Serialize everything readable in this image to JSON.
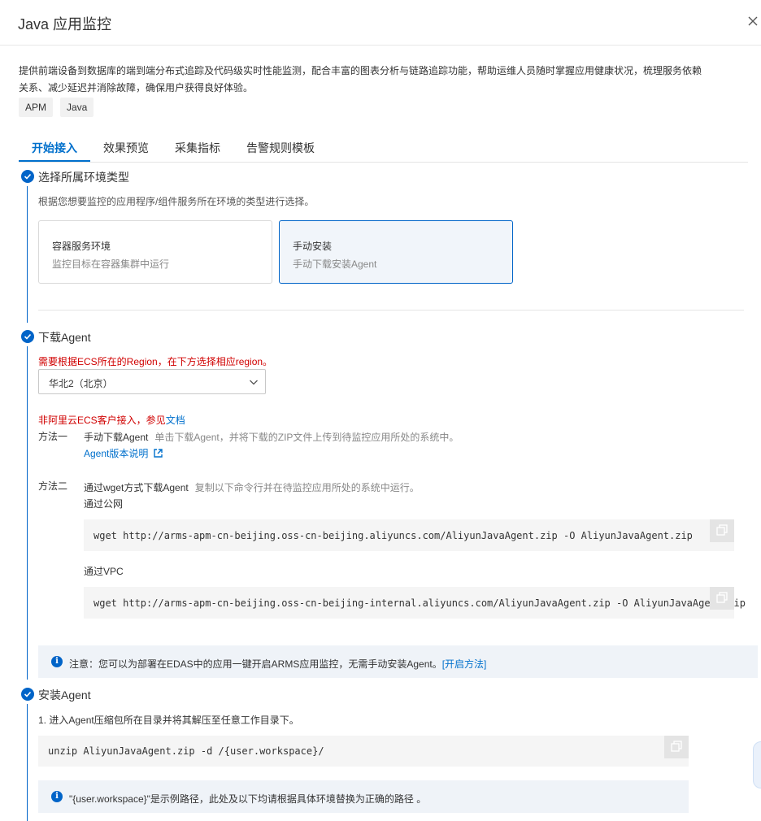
{
  "header": {
    "title": "Java 应用监控"
  },
  "description": "提供前端设备到数据库的端到端分布式追踪及代码级实时性能监测，配合丰富的图表分析与链路追踪功能，帮助运维人员随时掌握应用健康状况，梳理服务依赖关系、减少延迟并消除故障，确保用户获得良好体验。",
  "tags": [
    "APM",
    "Java"
  ],
  "tabs": [
    "开始接入",
    "效果预览",
    "采集指标",
    "告警规则模板"
  ],
  "step1": {
    "title": "选择所属环境类型",
    "hint": "根据您想要监控的应用程序/组件服务所在环境的类型进行选择。",
    "cards": [
      {
        "title": "容器服务环境",
        "subtitle": "监控目标在容器集群中运行"
      },
      {
        "title": "手动安装",
        "subtitle": "手动下载安装Agent"
      }
    ]
  },
  "step2": {
    "title": "下载Agent",
    "region_warning": "需要根据ECS所在的Region，在下方选择相应region。",
    "region_value": "华北2（北京）",
    "non_aliyun_text": "非阿里云ECS客户接入，参见",
    "non_aliyun_link": "文档",
    "method1": {
      "label": "方法一",
      "name": "手动下载Agent",
      "desc": "单击下载Agent，并将下载的ZIP文件上传到待监控应用所处的系统中。",
      "link": "Agent版本说明"
    },
    "method2": {
      "label": "方法二",
      "name": "通过wget方式下载Agent",
      "desc": "复制以下命令行并在待监控应用所处的系统中运行。",
      "public_label": "通过公网",
      "public_cmd": "wget http://arms-apm-cn-beijing.oss-cn-beijing.aliyuncs.com/AliyunJavaAgent.zip -O AliyunJavaAgent.zip",
      "vpc_label": "通过VPC",
      "vpc_cmd": "wget http://arms-apm-cn-beijing.oss-cn-beijing-internal.aliyuncs.com/AliyunJavaAgent.zip -O AliyunJavaAgent.zip"
    },
    "notice_text": "注意：您可以为部署在EDAS中的应用一键开启ARMS应用监控，无需手动安装Agent。",
    "notice_link": "[开启方法]"
  },
  "step3": {
    "title": "安装Agent",
    "hint": "1. 进入Agent压缩包所在目录并将其解压至任意工作目录下。",
    "cmd": "unzip AliyunJavaAgent.zip -d /{user.workspace}/",
    "notice_text": "\"{user.workspace}\"是示例路径，此处及以下均请根据具体环境替换为正确的路径 。"
  },
  "colors": {
    "primary": "#0064c8",
    "warning": "#d00000",
    "notice_bg": "#eff3f8",
    "code_bg": "#f5f5f5"
  }
}
